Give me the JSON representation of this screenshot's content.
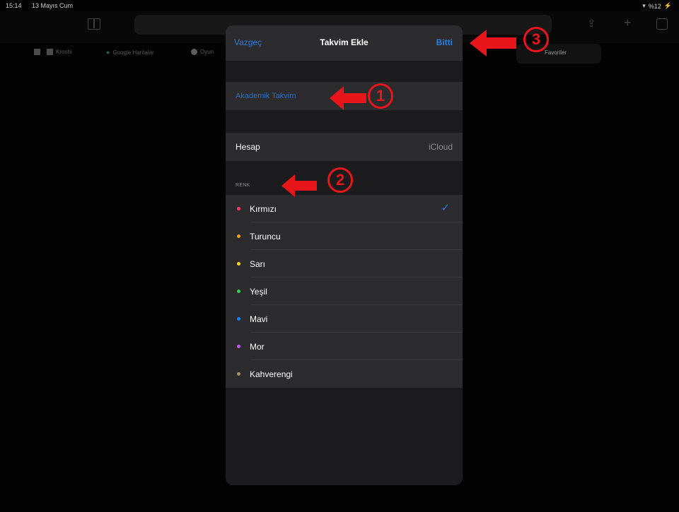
{
  "status_bar": {
    "time": "15:14",
    "date": "13 Mayıs Cum",
    "battery": "%12"
  },
  "bookmarks": [
    "Kroshi",
    "Google Haritalar",
    "Oyun"
  ],
  "favorites_label": "Favoriler",
  "modal": {
    "cancel": "Vazgeç",
    "title": "Takvim Ekle",
    "done": "Bitti",
    "calendar_name": "Akademik Takvim",
    "account_label": "Hesap",
    "account_value": "iCloud",
    "color_section_header": "RENK",
    "colors": [
      {
        "label": "Kırmızı",
        "color": "#ff375f",
        "selected": true
      },
      {
        "label": "Turuncu",
        "color": "#ff9f0a",
        "selected": false
      },
      {
        "label": "Sarı",
        "color": "#ffd60a",
        "selected": false
      },
      {
        "label": "Yeşil",
        "color": "#30d158",
        "selected": false
      },
      {
        "label": "Mavi",
        "color": "#0a84ff",
        "selected": false
      },
      {
        "label": "Mor",
        "color": "#bf5af2",
        "selected": false
      },
      {
        "label": "Kahverengi",
        "color": "#ac8e68",
        "selected": false
      }
    ]
  },
  "annotations": [
    "1",
    "2",
    "3"
  ],
  "accent_color": "#2b7de1",
  "annotation_color": "#e8161b"
}
